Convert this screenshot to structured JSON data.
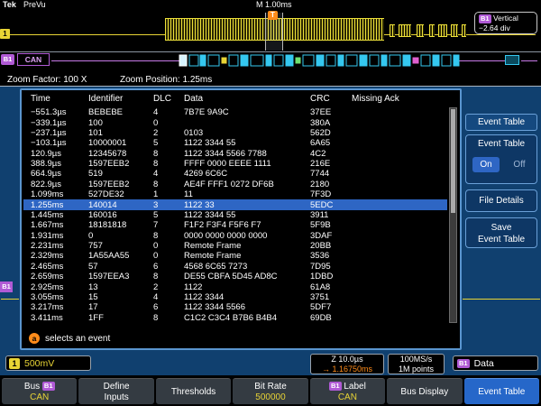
{
  "top_bar": {
    "brand": "Tek",
    "acq_status": "PreVu",
    "main_timebase": "M 1.00ms",
    "vertical_readout": {
      "bus_badge": "B1",
      "label": "Vertical",
      "value": "−2.64 div"
    }
  },
  "waveform": {
    "ch1_badge": "1",
    "trigger_marker": "T",
    "bus_badge": "B1",
    "bus_label": "CAN",
    "zoom_factor": "Zoom Factor: 100 X",
    "zoom_position": "Zoom Position: 1.25ms"
  },
  "icons": {
    "delay_arrow": "→"
  },
  "event_table": {
    "columns": [
      "Time",
      "Identifier",
      "DLC",
      "Data",
      "CRC",
      "Missing Ack"
    ],
    "selected_index": 9,
    "knob_label": "a",
    "knob_hint": "selects an event",
    "rows": [
      {
        "time": "−551.3µs",
        "identifier": "BEBEBE",
        "dlc": "4",
        "data": "7B7E 9A9C",
        "crc": "37EE",
        "missing_ack": ""
      },
      {
        "time": "−339.1µs",
        "identifier": "100",
        "dlc": "0",
        "data": "",
        "crc": "380A",
        "missing_ack": ""
      },
      {
        "time": "−237.1µs",
        "identifier": "101",
        "dlc": "2",
        "data": "0103",
        "crc": "562D",
        "missing_ack": ""
      },
      {
        "time": "−103.1µs",
        "identifier": "10000001",
        "dlc": "5",
        "data": "1122 3344 55",
        "crc": "6A65",
        "missing_ack": ""
      },
      {
        "time": "120.9µs",
        "identifier": "12345678",
        "dlc": "8",
        "data": "1122 3344 5566 7788",
        "crc": "4C2",
        "missing_ack": ""
      },
      {
        "time": "388.9µs",
        "identifier": "1597EEB2",
        "dlc": "8",
        "data": "FFFF 0000 EEEE 1111",
        "crc": "216E",
        "missing_ack": ""
      },
      {
        "time": "664.9µs",
        "identifier": "519",
        "dlc": "4",
        "data": "4269 6C6C",
        "crc": "7744",
        "missing_ack": ""
      },
      {
        "time": "822.9µs",
        "identifier": "1597EEB2",
        "dlc": "8",
        "data": "AE4F FFF1 0272 DF6B",
        "crc": "2180",
        "missing_ack": ""
      },
      {
        "time": "1.099ms",
        "identifier": "527DE32",
        "dlc": "1",
        "data": "11",
        "crc": "7F3D",
        "missing_ack": ""
      },
      {
        "time": "1.255ms",
        "identifier": "140014",
        "dlc": "3",
        "data": "1122 33",
        "crc": "5EDC",
        "missing_ack": ""
      },
      {
        "time": "1.445ms",
        "identifier": "160016",
        "dlc": "5",
        "data": "1122 3344 55",
        "crc": "3911",
        "missing_ack": ""
      },
      {
        "time": "1.667ms",
        "identifier": "18181818",
        "dlc": "7",
        "data": "F1F2 F3F4 F5F6 F7",
        "crc": "5F9B",
        "missing_ack": ""
      },
      {
        "time": "1.931ms",
        "identifier": "0",
        "dlc": "8",
        "data": "0000 0000 0000 0000",
        "crc": "3DAF",
        "missing_ack": ""
      },
      {
        "time": "2.231ms",
        "identifier": "757",
        "dlc": "0",
        "data": "Remote Frame",
        "crc": "20BB",
        "missing_ack": ""
      },
      {
        "time": "2.329ms",
        "identifier": "1A55AA55",
        "dlc": "0",
        "data": "Remote Frame",
        "crc": "3536",
        "missing_ack": ""
      },
      {
        "time": "2.465ms",
        "identifier": "57",
        "dlc": "6",
        "data": "4568 6C65 7273",
        "crc": "7D95",
        "missing_ack": ""
      },
      {
        "time": "2.659ms",
        "identifier": "1597EEA3",
        "dlc": "8",
        "data": "DE55 CBFA 5D45 AD8C",
        "crc": "1DBD",
        "missing_ack": ""
      },
      {
        "time": "2.925ms",
        "identifier": "13",
        "dlc": "2",
        "data": "1122",
        "crc": "61A8",
        "missing_ack": ""
      },
      {
        "time": "3.055ms",
        "identifier": "15",
        "dlc": "4",
        "data": "1122 3344",
        "crc": "3751",
        "missing_ack": ""
      },
      {
        "time": "3.217ms",
        "identifier": "17",
        "dlc": "6",
        "data": "1122 3344 5566",
        "crc": "5DF7",
        "missing_ack": ""
      },
      {
        "time": "3.411ms",
        "identifier": "1FF",
        "dlc": "8",
        "data": "C1C2 C3C4 B7B6 B4B4",
        "crc": "69DB",
        "missing_ack": ""
      }
    ]
  },
  "side_menu": {
    "title": "Event Table",
    "toggle": {
      "label": "Event Table",
      "on": "On",
      "off": "Off",
      "state": "On"
    },
    "file_details": "File Details",
    "save": {
      "line1": "Save",
      "line2": "Event Table"
    }
  },
  "status_bar": {
    "ch1": {
      "badge": "1",
      "scale": "500mV"
    },
    "zoom_timebase": "Z 10.0µs",
    "delay": "1.16750ms",
    "sample_rate": "100MS/s",
    "record_length": "1M points",
    "bus_badge": "B1",
    "bus_readout": "Data"
  },
  "bottom_menu": {
    "items": [
      {
        "name": "bus",
        "line1": {
          "pre": "Bus ",
          "badge": "B1"
        },
        "line2": {
          "text": "CAN",
          "accent": true
        }
      },
      {
        "name": "define-inputs",
        "line1": {
          "pre": "Define"
        },
        "line2": {
          "text": "Inputs"
        }
      },
      {
        "name": "thresholds",
        "line1": {
          "pre": "Thresholds"
        }
      },
      {
        "name": "bit-rate",
        "line1": {
          "pre": "Bit Rate"
        },
        "line2": {
          "text": "500000",
          "accent": true
        }
      },
      {
        "name": "label",
        "line1": {
          "badge": "B1",
          "post": " Label"
        },
        "line2": {
          "text": "CAN",
          "accent": true
        }
      },
      {
        "name": "bus-display",
        "line1": {
          "pre": "Bus Display"
        }
      },
      {
        "name": "event-table",
        "line1": {
          "pre": "Event Table"
        },
        "selected": true
      }
    ]
  }
}
